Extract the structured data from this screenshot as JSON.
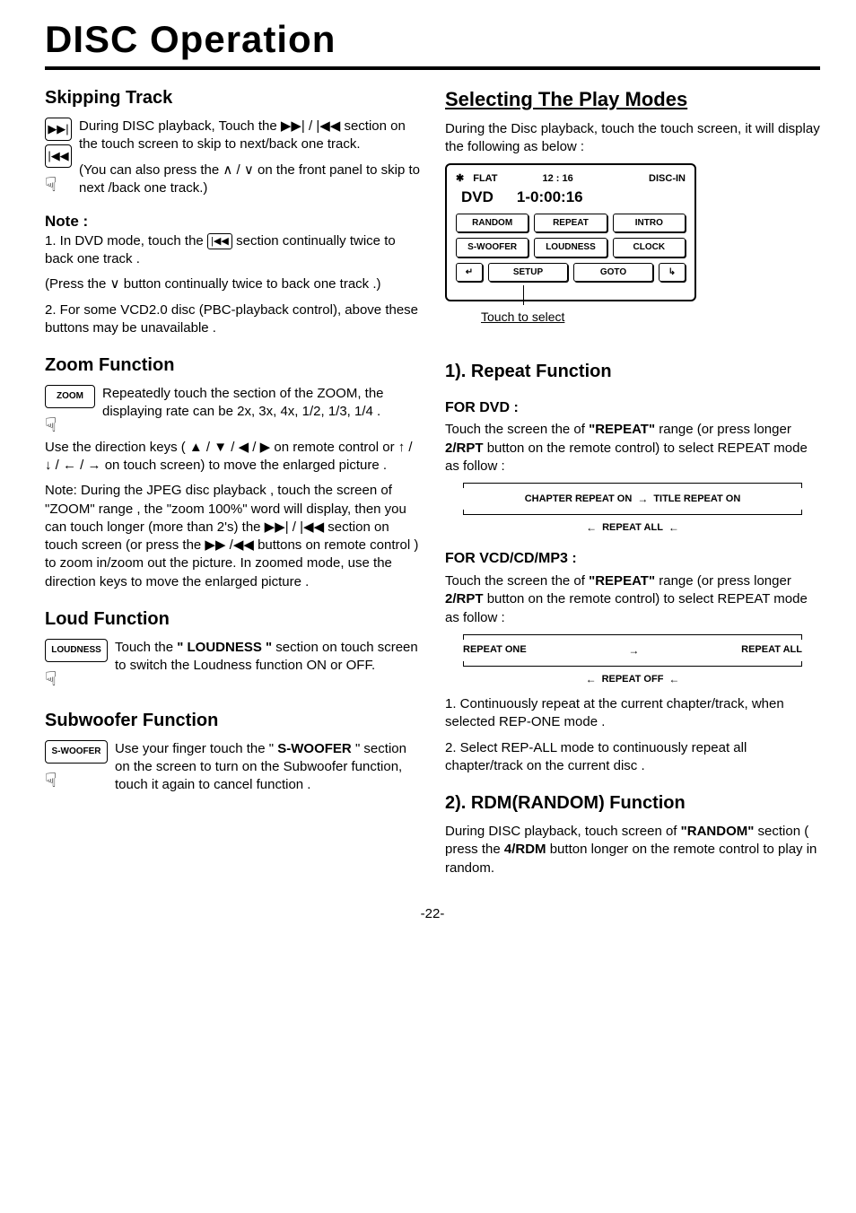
{
  "page_title": "DISC Operation",
  "page_number": "-22-",
  "left": {
    "skipping": {
      "heading": "Skipping Track",
      "text1_a": "During DISC playback, Touch the ",
      "text1_b": " section on the touch screen to skip to next/back one track.",
      "text2_a": "(You can also press the ",
      "text2_b": " on the front panel to skip to next /back one track.)",
      "note_label": "Note :",
      "note1_a": "1. In DVD mode, touch the ",
      "note1_b": " section continually twice to back one track .",
      "note2_a": "(Press the ",
      "note2_b": " button continually twice to back one track .)",
      "note3": "2. For some VCD2.0 disc (PBC-playback control), above these buttons may be unavailable ."
    },
    "zoom": {
      "heading": "Zoom Function",
      "btn": "ZOOM",
      "text1": "Repeatedly touch the section of the ZOOM, the displaying rate can be 2x, 3x, 4x, 1/2, 1/3, 1/4 .",
      "text2_a": "Use the direction keys ( ",
      "text2_b": " on remote control or ",
      "text2_c": " on touch screen) to move the enlarged picture .",
      "text3_a": "Note: During the JPEG disc playback , touch the screen of  \"ZOOM\" range , the \"zoom 100%\"  word will display, then you can touch longer (more than 2's) the ",
      "text3_b": " section on touch screen (or press the ",
      "text3_c": " buttons on remote control )  to zoom in/zoom out the picture. In zoomed mode, use the direction keys to move the enlarged picture ."
    },
    "loud": {
      "heading": "Loud Function",
      "btn": "LOUDNESS",
      "text_a": "Touch the ",
      "bold": "\" LOUDNESS \"",
      "text_b": " section on touch screen to switch the Loudness function ON or OFF."
    },
    "sw": {
      "heading": "Subwoofer Function",
      "btn": "S-WOOFER",
      "text_a": "Use your finger touch the \" ",
      "bold": "S-WOOFER",
      "text_b": " \" section on the screen to turn on the Subwoofer function, touch it again to cancel function ."
    }
  },
  "right": {
    "select": {
      "heading": "Selecting The Play Modes",
      "intro": "During the Disc playback, touch the touch screen, it will display the following as below :",
      "caption": "Touch to select"
    },
    "screen": {
      "flat": "FLAT",
      "time": "12 : 16",
      "discin": "DISC-IN",
      "dvd": "DVD",
      "pos": "1-0:00:16",
      "b_random": "RANDOM",
      "b_repeat": "REPEAT",
      "b_intro": "INTRO",
      "b_swoofer": "S-WOOFER",
      "b_loudness": "LOUDNESS",
      "b_clock": "CLOCK",
      "b_setup": "SETUP",
      "b_goto": "GOTO"
    },
    "repeat": {
      "heading": "1). Repeat Function",
      "dvd_label": "FOR  DVD :",
      "dvd_a": "Touch the screen the of ",
      "dvd_bold1": "\"REPEAT\"",
      "dvd_b": " range (or press longer ",
      "dvd_bold2": "2/RPT",
      "dvd_c": " button on the remote control) to select REPEAT mode as follow :",
      "flow_dvd_1": "CHAPTER REPEAT ON",
      "flow_dvd_2": "TITLE REPEAT ON",
      "flow_dvd_3": "REPEAT ALL",
      "vcd_label": "FOR  VCD/CD/MP3 :",
      "vcd_a": "Touch the screen the of ",
      "vcd_bold1": "\"REPEAT\"",
      "vcd_b": " range (or press longer ",
      "vcd_bold2": "2/RPT",
      "vcd_c": " button on the remote control) to select REPEAT mode as follow :",
      "flow_vcd_1": "REPEAT ONE",
      "flow_vcd_2": "REPEAT ALL",
      "flow_vcd_3": "REPEAT OFF",
      "foot1": "1. Continuously repeat at the current chapter/track, when selected REP-ONE mode .",
      "foot2": "2. Select REP-ALL mode to continuously repeat  all chapter/track on the current disc ."
    },
    "rdm": {
      "heading": "2). RDM(RANDOM) Function",
      "text_a": "During DISC playback, touch screen of ",
      "bold1": "\"RANDOM\"",
      "text_b": " section ( press the ",
      "bold2": "4/RDM",
      "text_c": " button longer on the remote control to play in random."
    }
  }
}
